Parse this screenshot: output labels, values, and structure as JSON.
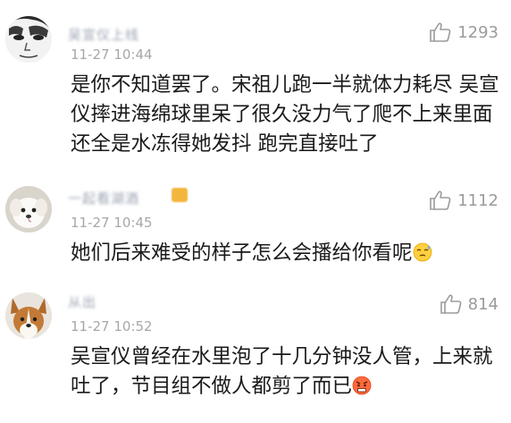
{
  "comments": [
    {
      "username": "吴宣仪上线",
      "timestamp": "11-27 10:44",
      "likes": "1293",
      "text": "是你不知道罢了。宋祖儿跑一半就体力耗尽 吴宣仪摔进海绵球里呆了很久没力气了爬不上来里面还全是水冻得她发抖 跑完直接吐了",
      "avatar_icon": "manga-portrait-icon"
    },
    {
      "username": "一起看湖酒",
      "timestamp": "11-27 10:45",
      "likes": "1112",
      "text": "她们后来难受的样子怎么会播给你看呢",
      "avatar_icon": "white-puppy-icon",
      "emoji_icon": "sweat-face-icon"
    },
    {
      "username": "从出",
      "timestamp": "11-27 10:52",
      "likes": "814",
      "text": "吴宣仪曾经在水里泡了十几分钟没人管，上来就吐了，节目组不做人都剪了而已",
      "avatar_icon": "corgi-icon",
      "emoji_icon": "angry-face-icon"
    }
  ],
  "colors": {
    "like_gray": "#9b9b9b",
    "time_gray": "#a7a7a7",
    "text_black": "#1a1a1a"
  }
}
